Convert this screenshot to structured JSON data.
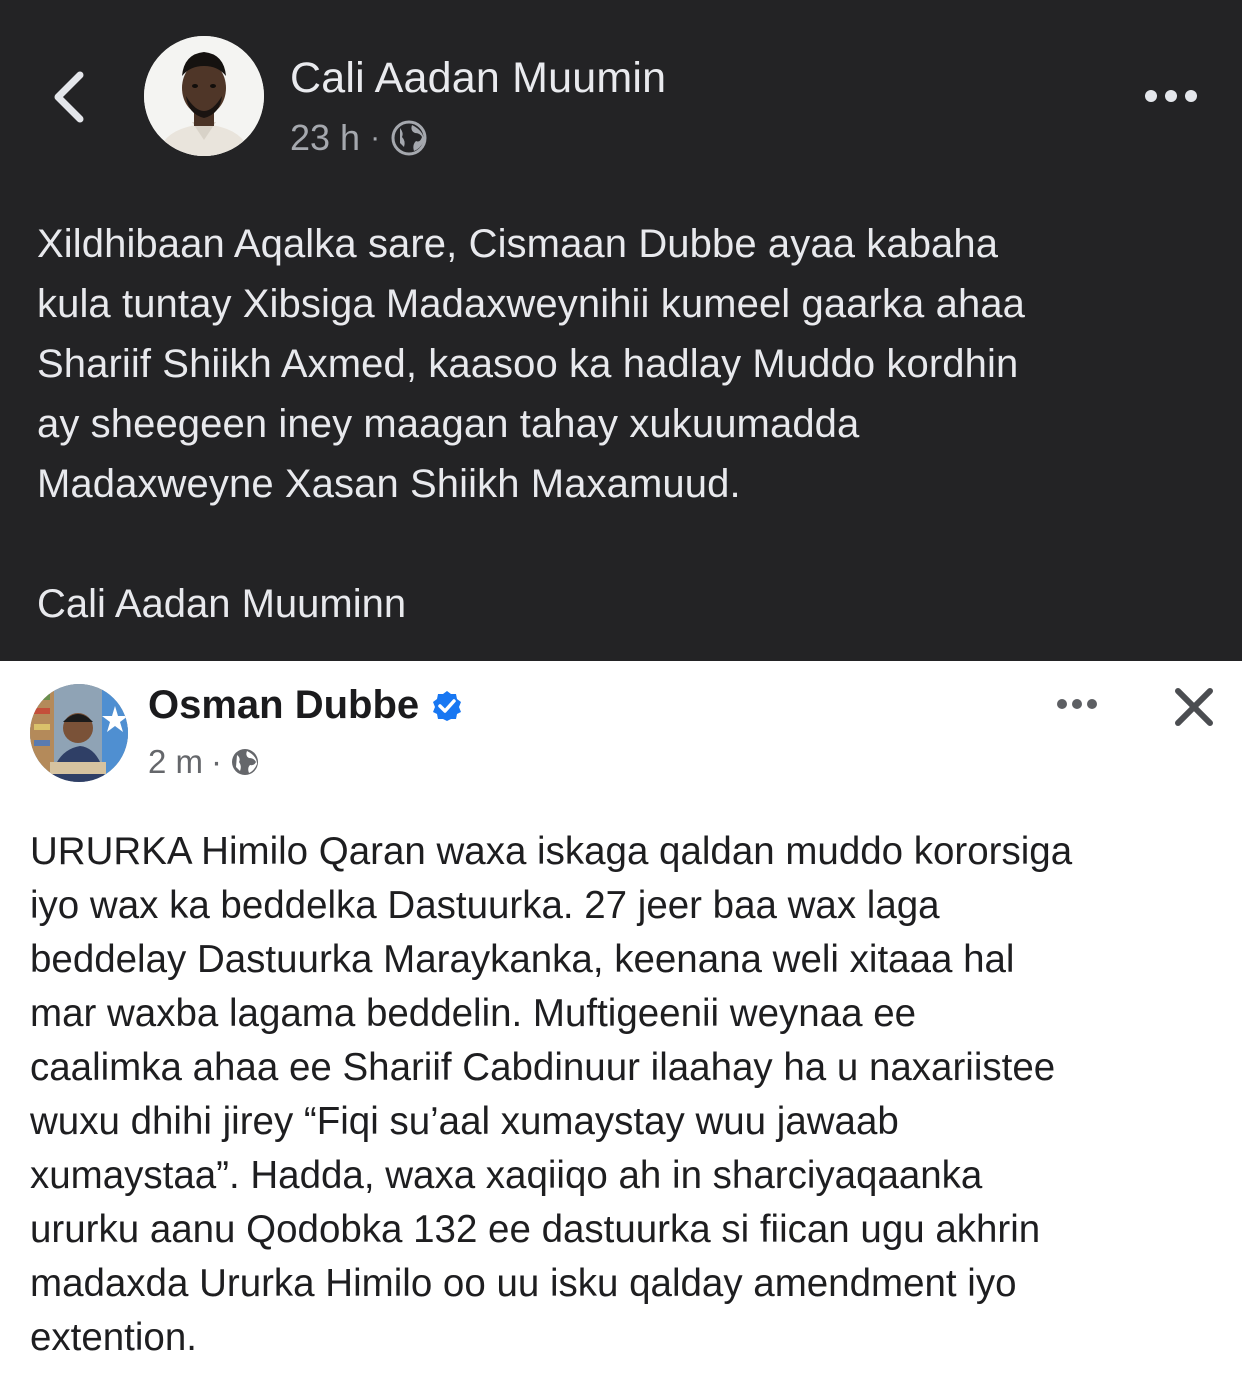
{
  "post": {
    "author": "Cali Aadan Muumin",
    "time": "23 h",
    "separator": "·",
    "icons": {
      "back": "chevron-left-icon",
      "privacy": "globe-icon",
      "more": "more-horizontal-icon"
    },
    "body_lines": [
      "Xildhibaan Aqalka sare, Cismaan Dubbe ayaa kabaha",
      "kula tuntay Xibsiga Madaxweynihii kumeel gaarka ahaa",
      "Shariif Shiikh Axmed, kaasoo ka hadlay Muddo kordhin",
      "ay sheegeen iney maagan tahay xukuumadda",
      "Madaxweyne Xasan Shiikh Maxamuud."
    ],
    "signature": "Cali Aadan Muuminn"
  },
  "shared": {
    "author": "Osman Dubbe",
    "time": "2 m",
    "separator": "·",
    "verified": true,
    "icons": {
      "verified": "verified-badge-icon",
      "privacy": "globe-icon",
      "more": "more-horizontal-icon",
      "close": "close-icon"
    },
    "body_lines": [
      "URURKA Himilo Qaran waxa iskaga qaldan muddo kororsiga",
      "iyo wax ka beddelka Dastuurka. 27 jeer baa wax laga",
      "beddelay Dastuurka Maraykanka, keenana weli xitaaa hal",
      "mar waxba lagama beddelin. Muftigeenii weynaa ee",
      "caalimka ahaa ee Shariif Cabdinuur ilaahay ha u naxariistee",
      "wuxu dhihi jirey “Fiqi su’aal xumaystay wuu jawaab",
      "xumaystaa”. Hadda, waxa xaqiiqo ah in sharciyaqaanka",
      "ururku aanu Qodobka 132 ee dastuurka si fiican ugu akhrin",
      "madaxda Ururka Himilo oo uu isku qalday amendment iyo",
      "extention."
    ]
  },
  "colors": {
    "dark_bg": "#232325",
    "dark_text": "#e8e9ed",
    "dark_meta": "#a5a8ae",
    "light_bg": "#ffffff",
    "light_text": "#1e1e20",
    "light_meta": "#65676b",
    "verified_blue": "#1877f2"
  }
}
